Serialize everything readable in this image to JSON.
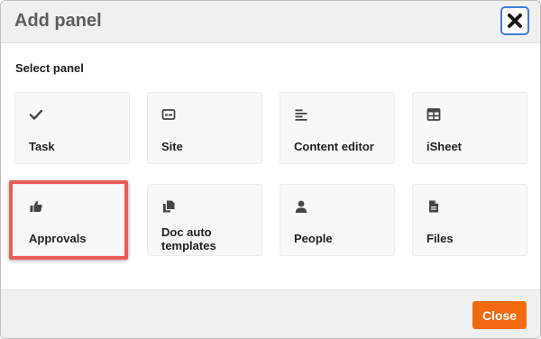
{
  "dialog": {
    "title": "Add panel",
    "close_icon": "close-x-icon",
    "section_label": "Select panel",
    "panels": [
      {
        "label": "Task",
        "icon": "checkmark-icon"
      },
      {
        "label": "Site",
        "icon": "site-icon"
      },
      {
        "label": "Content editor",
        "icon": "align-left-icon"
      },
      {
        "label": "iSheet",
        "icon": "table-icon"
      },
      {
        "label": "Approvals",
        "icon": "thumbs-up-icon"
      },
      {
        "label": "Doc auto templates",
        "icon": "copy-documents-icon"
      },
      {
        "label": "People",
        "icon": "person-icon"
      },
      {
        "label": "Files",
        "icon": "file-icon"
      }
    ],
    "highlighted_panel": "Approvals",
    "close_button_label": "Close"
  },
  "colors": {
    "accent_close": "#f26a0f",
    "highlight_border": "#ea5c55",
    "focus_ring": "#3b7ddd"
  }
}
